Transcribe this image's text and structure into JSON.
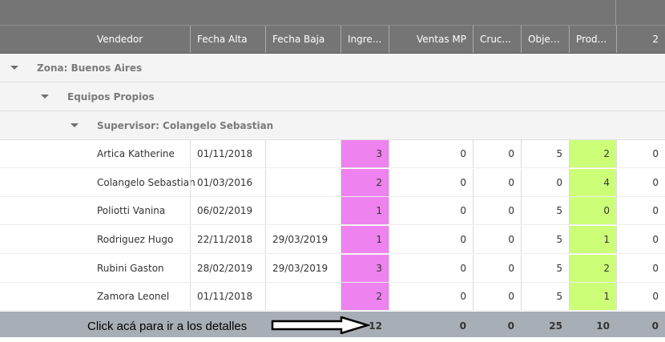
{
  "columns": [
    {
      "label": "Vendedor"
    },
    {
      "label": "Fecha Alta"
    },
    {
      "label": "Fecha Baja"
    },
    {
      "label": "Ingre..."
    },
    {
      "label": "Ventas MP"
    },
    {
      "label": "Cruc..."
    },
    {
      "label": "Objet..."
    },
    {
      "label": "Prod..."
    },
    {
      "label": "2"
    }
  ],
  "groups": {
    "zona": "Zona: Buenos Aires",
    "equipos": "Equipos Propios",
    "supervisor": "Supervisor: Colangelo Sebastian"
  },
  "rows": [
    {
      "vendedor": "Artica Katherine",
      "fecha_alta": "01/11/2018",
      "fecha_baja": "",
      "ingre": "3",
      "ventas_mp": "0",
      "cruc": "0",
      "objet": "5",
      "prod": "2",
      "c2": "0"
    },
    {
      "vendedor": "Colangelo Sebastian",
      "fecha_alta": "01/03/2016",
      "fecha_baja": "",
      "ingre": "2",
      "ventas_mp": "0",
      "cruc": "0",
      "objet": "0",
      "prod": "4",
      "c2": "0"
    },
    {
      "vendedor": "Poliotti Vanina",
      "fecha_alta": "06/02/2019",
      "fecha_baja": "",
      "ingre": "1",
      "ventas_mp": "0",
      "cruc": "0",
      "objet": "5",
      "prod": "0",
      "c2": "0"
    },
    {
      "vendedor": "Rodriguez Hugo",
      "fecha_alta": "22/11/2018",
      "fecha_baja": "29/03/2019",
      "ingre": "1",
      "ventas_mp": "0",
      "cruc": "0",
      "objet": "5",
      "prod": "1",
      "c2": "0"
    },
    {
      "vendedor": "Rubini Gaston",
      "fecha_alta": "28/02/2019",
      "fecha_baja": "29/03/2019",
      "ingre": "3",
      "ventas_mp": "0",
      "cruc": "0",
      "objet": "5",
      "prod": "2",
      "c2": "0"
    },
    {
      "vendedor": "Zamora Leonel",
      "fecha_alta": "01/11/2018",
      "fecha_baja": "",
      "ingre": "2",
      "ventas_mp": "0",
      "cruc": "0",
      "objet": "5",
      "prod": "1",
      "c2": "0"
    }
  ],
  "totals": {
    "ingre": "12",
    "ventas_mp": "0",
    "cruc": "0",
    "objet": "25",
    "prod": "10",
    "c2": "0"
  },
  "footer_note": "Click acá para ir a los detalles",
  "colors": {
    "header": "#757575",
    "ingre_highlight": "#ee82ee",
    "prod_highlight": "#ccff77",
    "footer": "#a8aeb5"
  }
}
